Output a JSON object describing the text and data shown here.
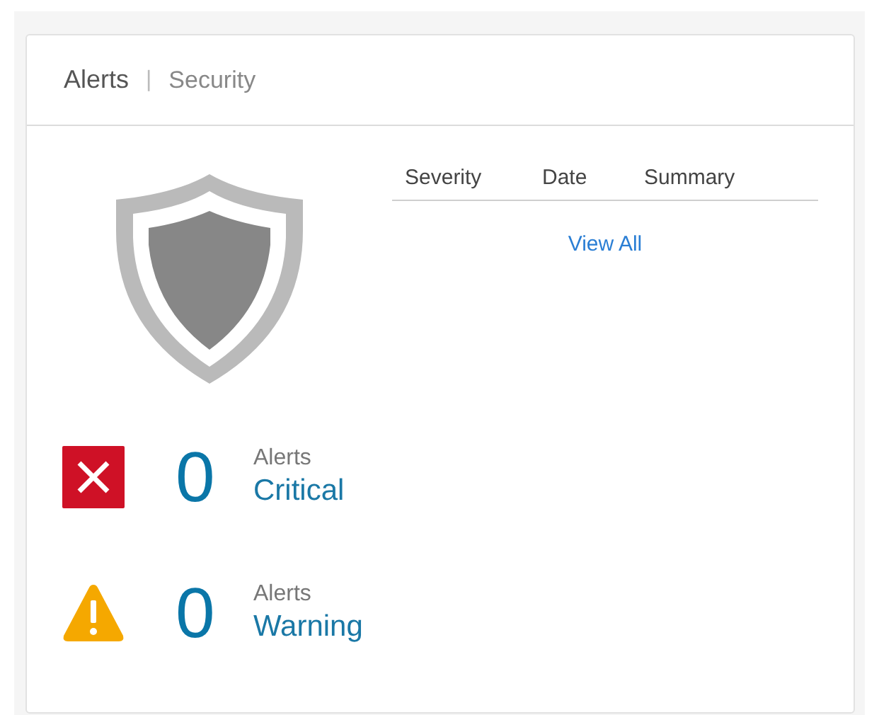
{
  "header": {
    "title": "Alerts",
    "separator": "|",
    "subtitle": "Security"
  },
  "table": {
    "columns": [
      "Severity",
      "Date",
      "Summary"
    ],
    "link": "View All"
  },
  "summaries": [
    {
      "kind": "critical",
      "count": "0",
      "caption": "Alerts",
      "label": "Critical"
    },
    {
      "kind": "warning",
      "count": "0",
      "caption": "Alerts",
      "label": "Warning"
    }
  ]
}
